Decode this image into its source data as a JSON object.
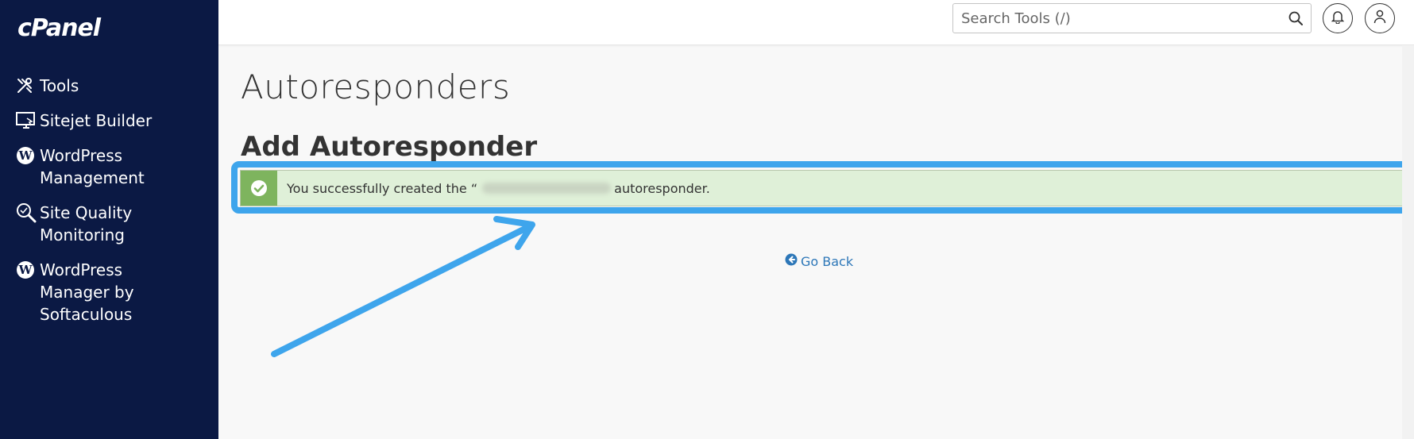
{
  "sidebar": {
    "logo": "cPanel",
    "items": [
      {
        "label": "Tools",
        "icon": "tools-icon"
      },
      {
        "label": "Sitejet Builder",
        "icon": "monitor-icon"
      },
      {
        "label": "WordPress\nManagement",
        "icon": "wordpress-icon"
      },
      {
        "label": "Site Quality\nMonitoring",
        "icon": "magnifier-icon"
      },
      {
        "label": " WordPress\n Manager by\nSoftaculous",
        "icon": "wordpress-icon"
      }
    ]
  },
  "header": {
    "search_placeholder": "Search Tools (/)",
    "icons": [
      "search-icon",
      "bell-icon",
      "user-icon"
    ]
  },
  "main": {
    "page_title": "Autoresponders",
    "section_title": "Add Autoresponder",
    "alert": {
      "text_before": "You successfully created the “",
      "text_after": " autoresponder.",
      "icon": "check-circle-icon"
    },
    "go_back_label": "Go Back"
  },
  "colors": {
    "sidebar_bg": "#0b1944",
    "alert_bg": "#dff0d8",
    "alert_icon_bg": "#7eb45e",
    "highlight": "#3ea5ec",
    "link": "#2d77b8"
  }
}
